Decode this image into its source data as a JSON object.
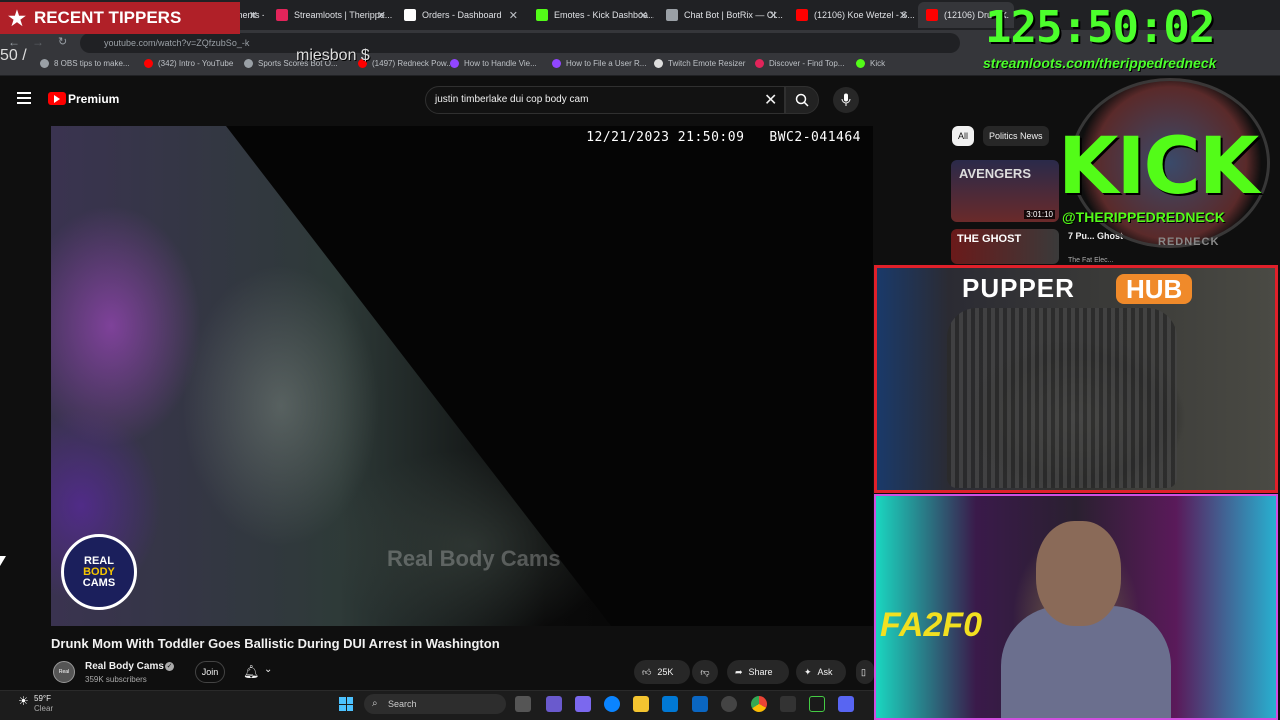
{
  "browser": {
    "tabs": [
      {
        "label": "...reamElements - rgu",
        "color": "#e8453c"
      },
      {
        "label": "Streamloots | Therippe...",
        "color": "#e2245a"
      },
      {
        "label": "Orders - Dashboard",
        "color": "#ffffff"
      },
      {
        "label": "Emotes - Kick Dashboa...",
        "color": "#53fc18"
      },
      {
        "label": "Chat Bot | BotRix — Cl...",
        "color": "#9aa0a6"
      },
      {
        "label": "(12106) Koe Wetzel - S...",
        "color": "#ff0000"
      },
      {
        "label": "(12106) Drunk...",
        "color": "#ff0000"
      }
    ],
    "url": "youtube.com/watch?v=ZQfzubSo_-k",
    "bookmarks": [
      {
        "label": "8 OBS tips to make...",
        "color": "#9aa0a6"
      },
      {
        "label": "(342) Intro - YouTube",
        "color": "#ff0000"
      },
      {
        "label": "Sports Scores Bot O...",
        "color": "#9aa0a6"
      },
      {
        "label": "(1497) Redneck Pow...",
        "color": "#ff0000"
      },
      {
        "label": "How to Handle Vie...",
        "color": "#9146ff"
      },
      {
        "label": "How to File a User R...",
        "color": "#9146ff"
      },
      {
        "label": "Twitch Emote Resizer",
        "color": "#dddddd"
      },
      {
        "label": "Discover - Find Top...",
        "color": "#e2245a"
      },
      {
        "label": "Kick",
        "color": "#53fc18"
      }
    ]
  },
  "youtube": {
    "logo_label": "Premium",
    "search_query": "justin timberlake dui cop body cam",
    "video": {
      "timestamp": "12/21/2023 21:50:09",
      "device_id": "BWC2-041464",
      "watermark": "Real Body Cams",
      "logo_text": [
        "REAL",
        "BODY",
        "CAMS"
      ],
      "title": "Drunk Mom With Toddler Goes Ballistic During DUI Arrest in Washington"
    },
    "channel": {
      "avatar_text": "Real",
      "name": "Real Body Cams",
      "subscribers": "359K subscribers",
      "join_label": "Join"
    },
    "actions": {
      "likes": "25K",
      "share": "Share",
      "ask": "Ask"
    },
    "chips": [
      "All",
      "Politics News"
    ],
    "related": [
      {
        "title": "",
        "duration": "3:01:10",
        "thumb": "AVENGERS"
      },
      {
        "title": "7 Pu... Ghost",
        "channel": "The Fat Elec...",
        "thumb": "THE GHOST"
      }
    ]
  },
  "overlays": {
    "recent_tippers": "RECENT TIPPERS",
    "tip_amount_prefix": "50 /",
    "tipper_name": "miesbon $",
    "timer": "125:50:02",
    "streamloots_url": "streamloots.com/therippedredneck",
    "kick_logo": "KICK",
    "kick_handle": "@THERIPPEDREDNECK",
    "redneck_banner": "REDNECK",
    "pupper_title": "PUPPER",
    "pupper_hub": "HUB",
    "cam_sign": "FA2F0"
  },
  "taskbar": {
    "temperature": "59°F",
    "condition": "Clear",
    "search_label": "Search"
  }
}
